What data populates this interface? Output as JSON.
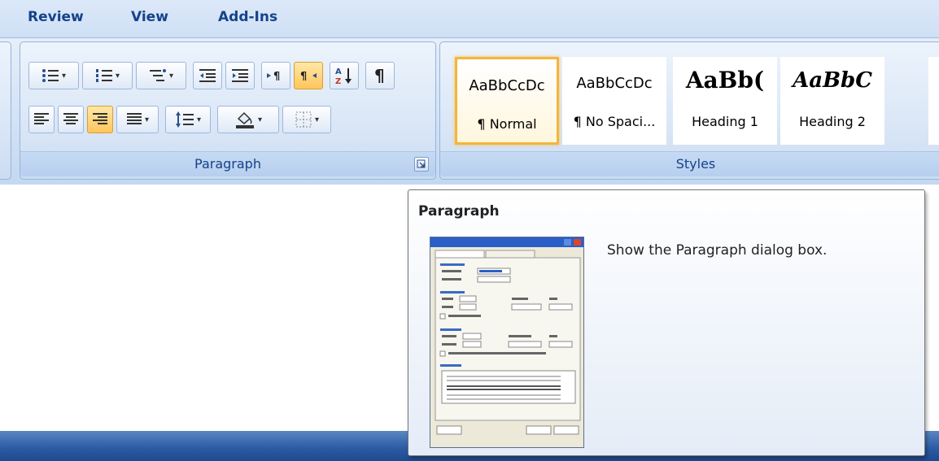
{
  "tabs": [
    "Review",
    "View",
    "Add-Ins"
  ],
  "paragraph_group": {
    "label": "Paragraph",
    "buttons_row1": [
      "bullets-icon",
      "numbering-icon",
      "multilevel-list-icon",
      "decrease-indent-icon",
      "increase-indent-icon",
      "left-to-right-icon",
      "right-to-left-icon",
      "sort-icon",
      "show-hide-marks-icon"
    ],
    "buttons_row2": [
      "align-left-icon",
      "align-center-icon",
      "align-right-icon",
      "justify-icon",
      "line-spacing-icon",
      "shading-icon",
      "borders-icon"
    ],
    "active_button": "align-right-icon"
  },
  "styles_group": {
    "label": "Styles",
    "items": [
      {
        "sample": "AaBbCcDc",
        "name": "¶ Normal",
        "selected": true
      },
      {
        "sample": "AaBbCcDc",
        "name": "¶ No Spaci...",
        "selected": false
      },
      {
        "sample": "AaBb(",
        "name": "Heading 1",
        "selected": false
      },
      {
        "sample": "AaBbC",
        "name": "Heading 2",
        "selected": false
      }
    ]
  },
  "tooltip": {
    "title": "Paragraph",
    "description": "Show the Paragraph dialog box."
  },
  "colors": {
    "accent": "#15428b",
    "active_button": "#ffc55c",
    "selected_style_border": "#f3b53c",
    "bottom_bar": "#2a5aa3"
  }
}
